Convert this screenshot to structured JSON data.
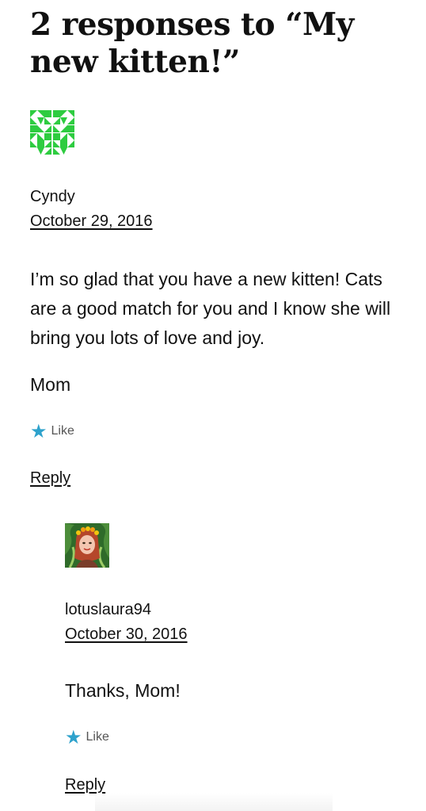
{
  "heading": {
    "title": "2 responses to “My new kitten!”"
  },
  "comments": [
    {
      "author": "Cyndy",
      "date": "October 29, 2016",
      "paragraphs": [
        "I’m so glad that you have a new kitten! Cats are a good match for you and I know she will bring you lots of love and joy.",
        "Mom"
      ],
      "like_label": "Like",
      "reply_label": "Reply",
      "avatar": "green-geometric-identicon"
    },
    {
      "author": "lotuslaura94",
      "date": "October 30, 2016",
      "paragraphs": [
        "Thanks, Mom!"
      ],
      "like_label": "Like",
      "reply_label": "Reply",
      "avatar": "illustrated-portrait-avatar"
    }
  ],
  "colors": {
    "like_star": "#2ea2cc",
    "identicon_green": "#2ecc40",
    "text": "#111111"
  }
}
